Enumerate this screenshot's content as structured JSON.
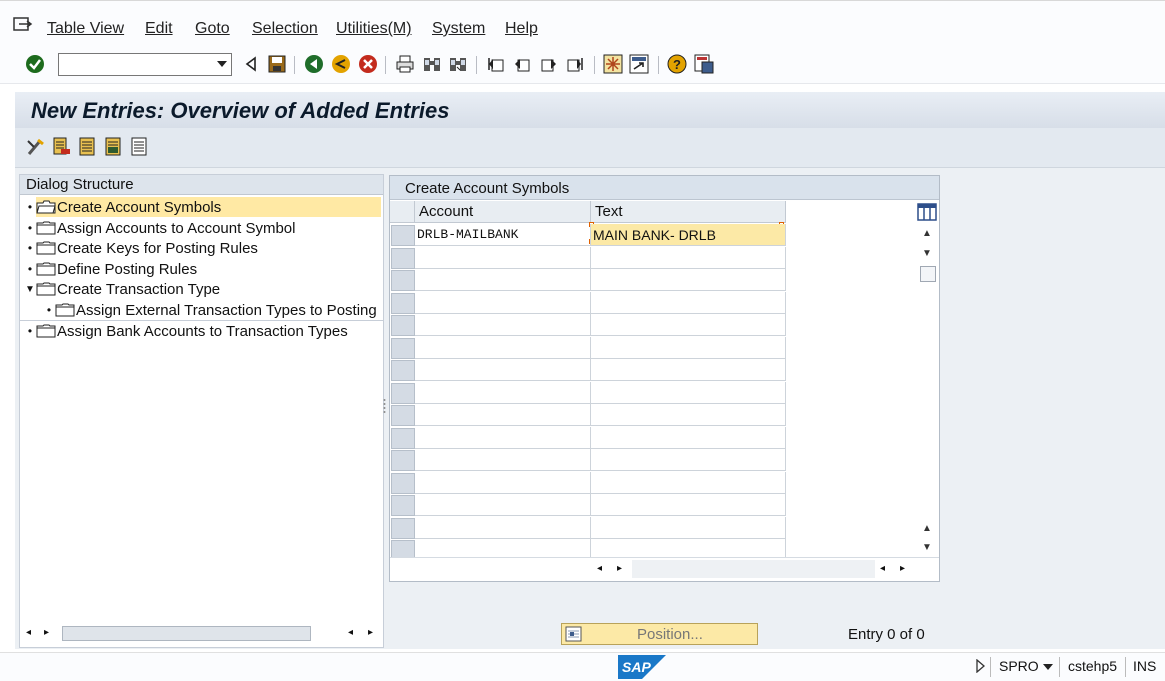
{
  "menu": {
    "items": [
      "Table View",
      "Edit",
      "Goto",
      "Selection",
      "Utilities(M)",
      "System",
      "Help"
    ]
  },
  "toolbar": {
    "command_field_value": "",
    "icons": [
      "enter-icon",
      "command-dropdown-icon",
      "back-arrow-icon",
      "save-icon",
      "back-icon",
      "exit-icon",
      "cancel-icon",
      "print-icon",
      "find-icon",
      "find-next-icon",
      "first-page-icon",
      "previous-page-icon",
      "next-page-icon",
      "last-page-icon",
      "create-session-icon",
      "shortcut-icon",
      "help-icon",
      "layout-icon"
    ]
  },
  "title": "New Entries: Overview of Added Entries",
  "dialog_structure": {
    "heading": "Dialog Structure",
    "items": [
      {
        "label": "Create Account Symbols",
        "selected": true,
        "level": 0,
        "expanded": false
      },
      {
        "label": "Assign Accounts to Account Symbol",
        "selected": false,
        "level": 0,
        "expanded": false
      },
      {
        "label": "Create Keys for Posting Rules",
        "selected": false,
        "level": 0,
        "expanded": false
      },
      {
        "label": "Define Posting Rules",
        "selected": false,
        "level": 0,
        "expanded": false
      },
      {
        "label": "Create Transaction Type",
        "selected": false,
        "level": 0,
        "expanded": true
      },
      {
        "label": "Assign External Transaction Types to Posting",
        "selected": false,
        "level": 1,
        "expanded": false
      },
      {
        "label": "Assign Bank Accounts to Transaction Types",
        "selected": false,
        "level": 0,
        "expanded": false
      }
    ]
  },
  "table": {
    "title": "Create Account Symbols",
    "columns": [
      "Account",
      "Text"
    ],
    "rows": [
      {
        "account": "DRLB-MAILBANK",
        "text": "MAIN BANK- DRLB"
      }
    ]
  },
  "position_button": "Position...",
  "entry_status": "Entry 0 of 0",
  "status_bar": {
    "transaction": "SPRO",
    "server": "cstehp5",
    "mode": "INS",
    "logo": "SAP"
  }
}
